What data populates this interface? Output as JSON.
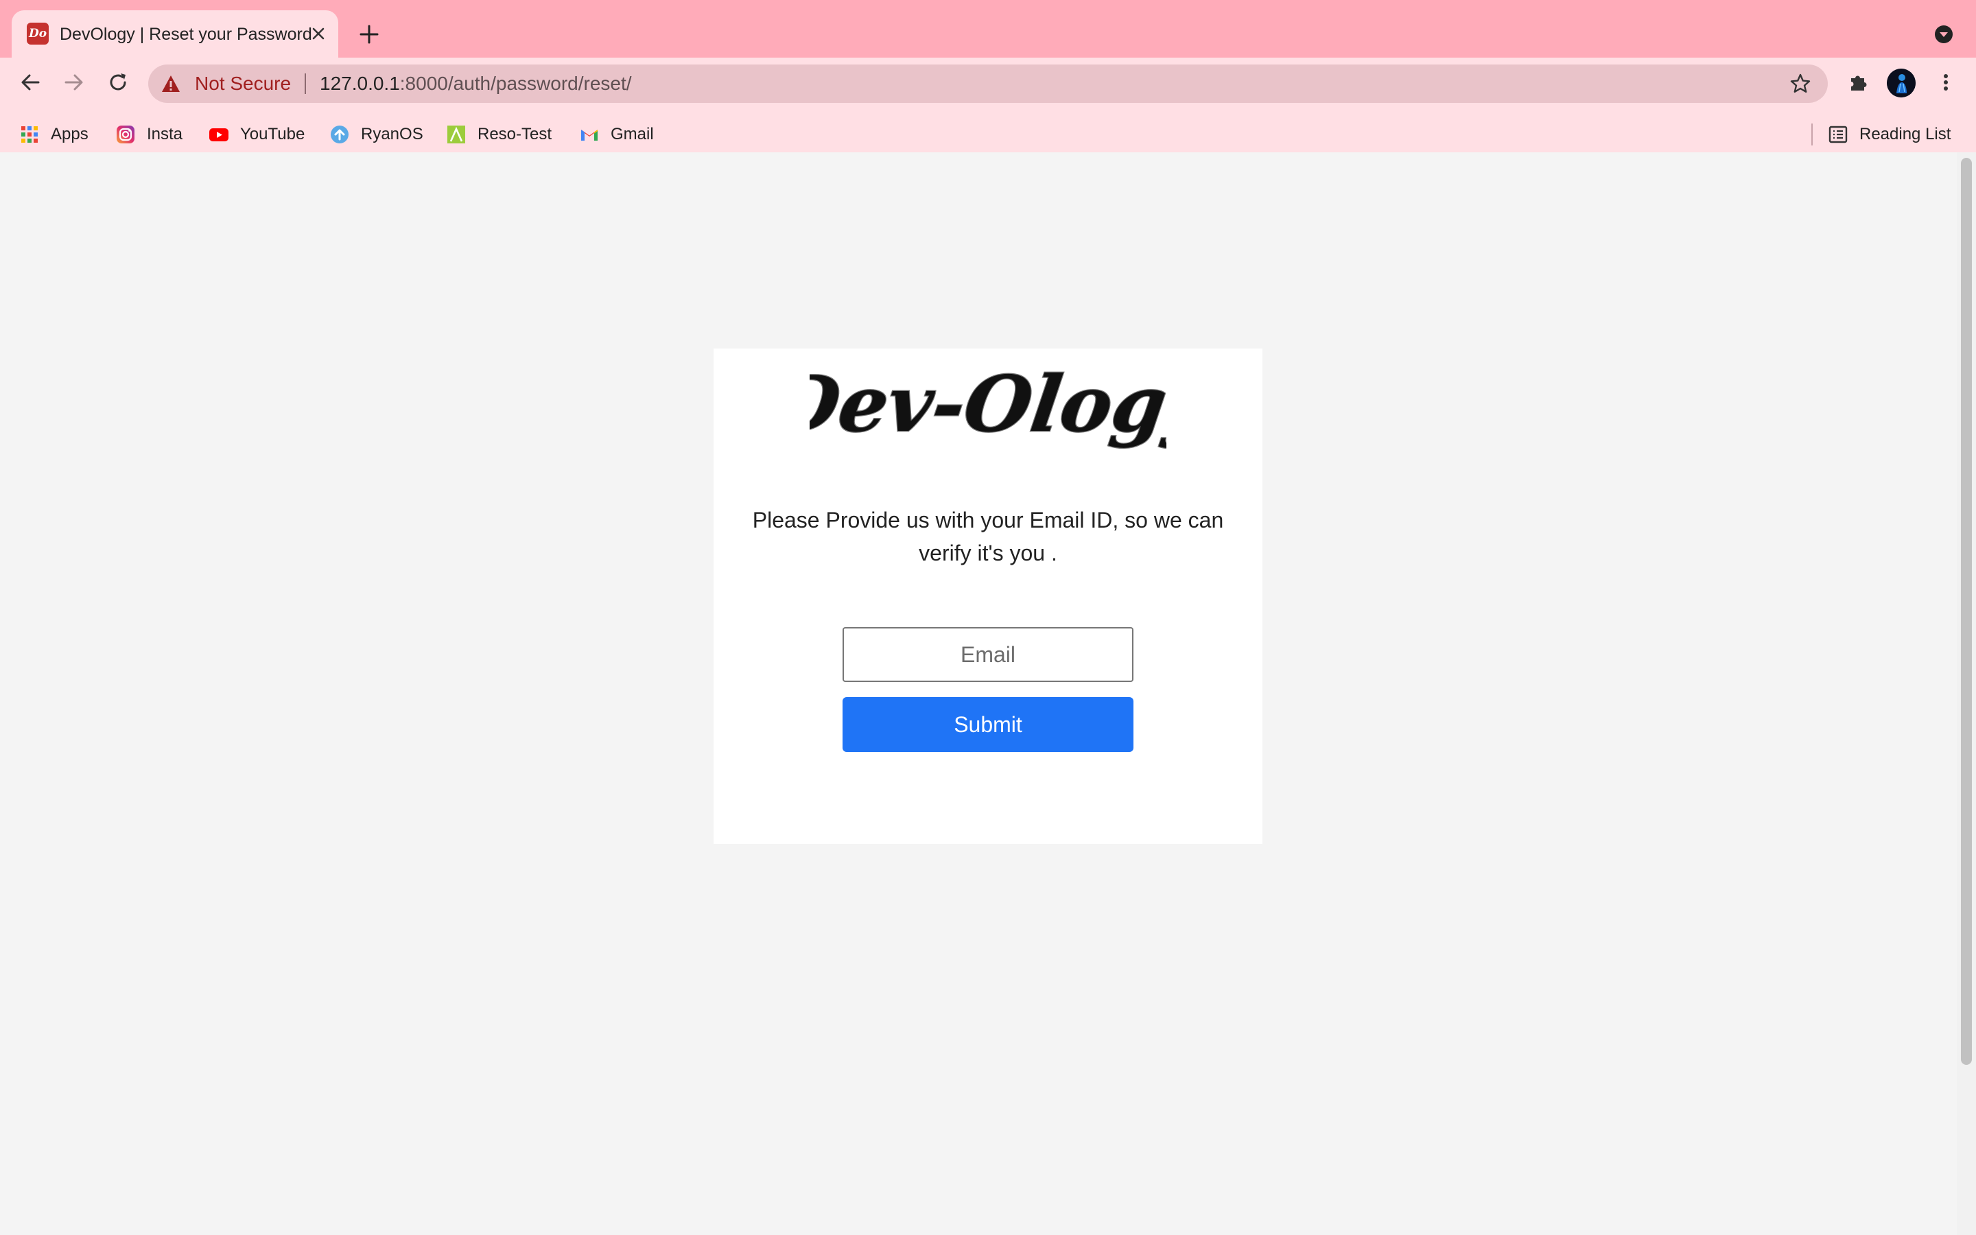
{
  "browser": {
    "tab": {
      "favicon_text": "Do",
      "title": "DevOlogy | Reset your Password"
    },
    "omnibox": {
      "security_label": "Not Secure",
      "url_host": "127.0.0.1",
      "url_path": ":8000/auth/password/reset/"
    },
    "bookmarks": [
      {
        "label": "Apps",
        "icon": "apps-grid-icon"
      },
      {
        "label": "Insta",
        "icon": "instagram-icon"
      },
      {
        "label": "YouTube",
        "icon": "youtube-icon"
      },
      {
        "label": "RyanOS",
        "icon": "upload-cloud-icon"
      },
      {
        "label": "Reso-Test",
        "icon": "reso-test-icon"
      },
      {
        "label": "Gmail",
        "icon": "gmail-icon"
      }
    ],
    "reading_list": "Reading List",
    "colors": {
      "tabstrip": "#ffabb9",
      "toolbar": "#ffdfe4",
      "omnibox": "#e9c3c9"
    }
  },
  "page": {
    "logo_text": "Dev-Ology",
    "instruction": "Please Provide us with your Email ID, so we can verify it's you .",
    "email": {
      "placeholder": "Email",
      "value": ""
    },
    "submit_label": "Submit",
    "colors": {
      "background": "#f4f4f4",
      "card": "#ffffff",
      "submit": "#1f74f6"
    }
  }
}
